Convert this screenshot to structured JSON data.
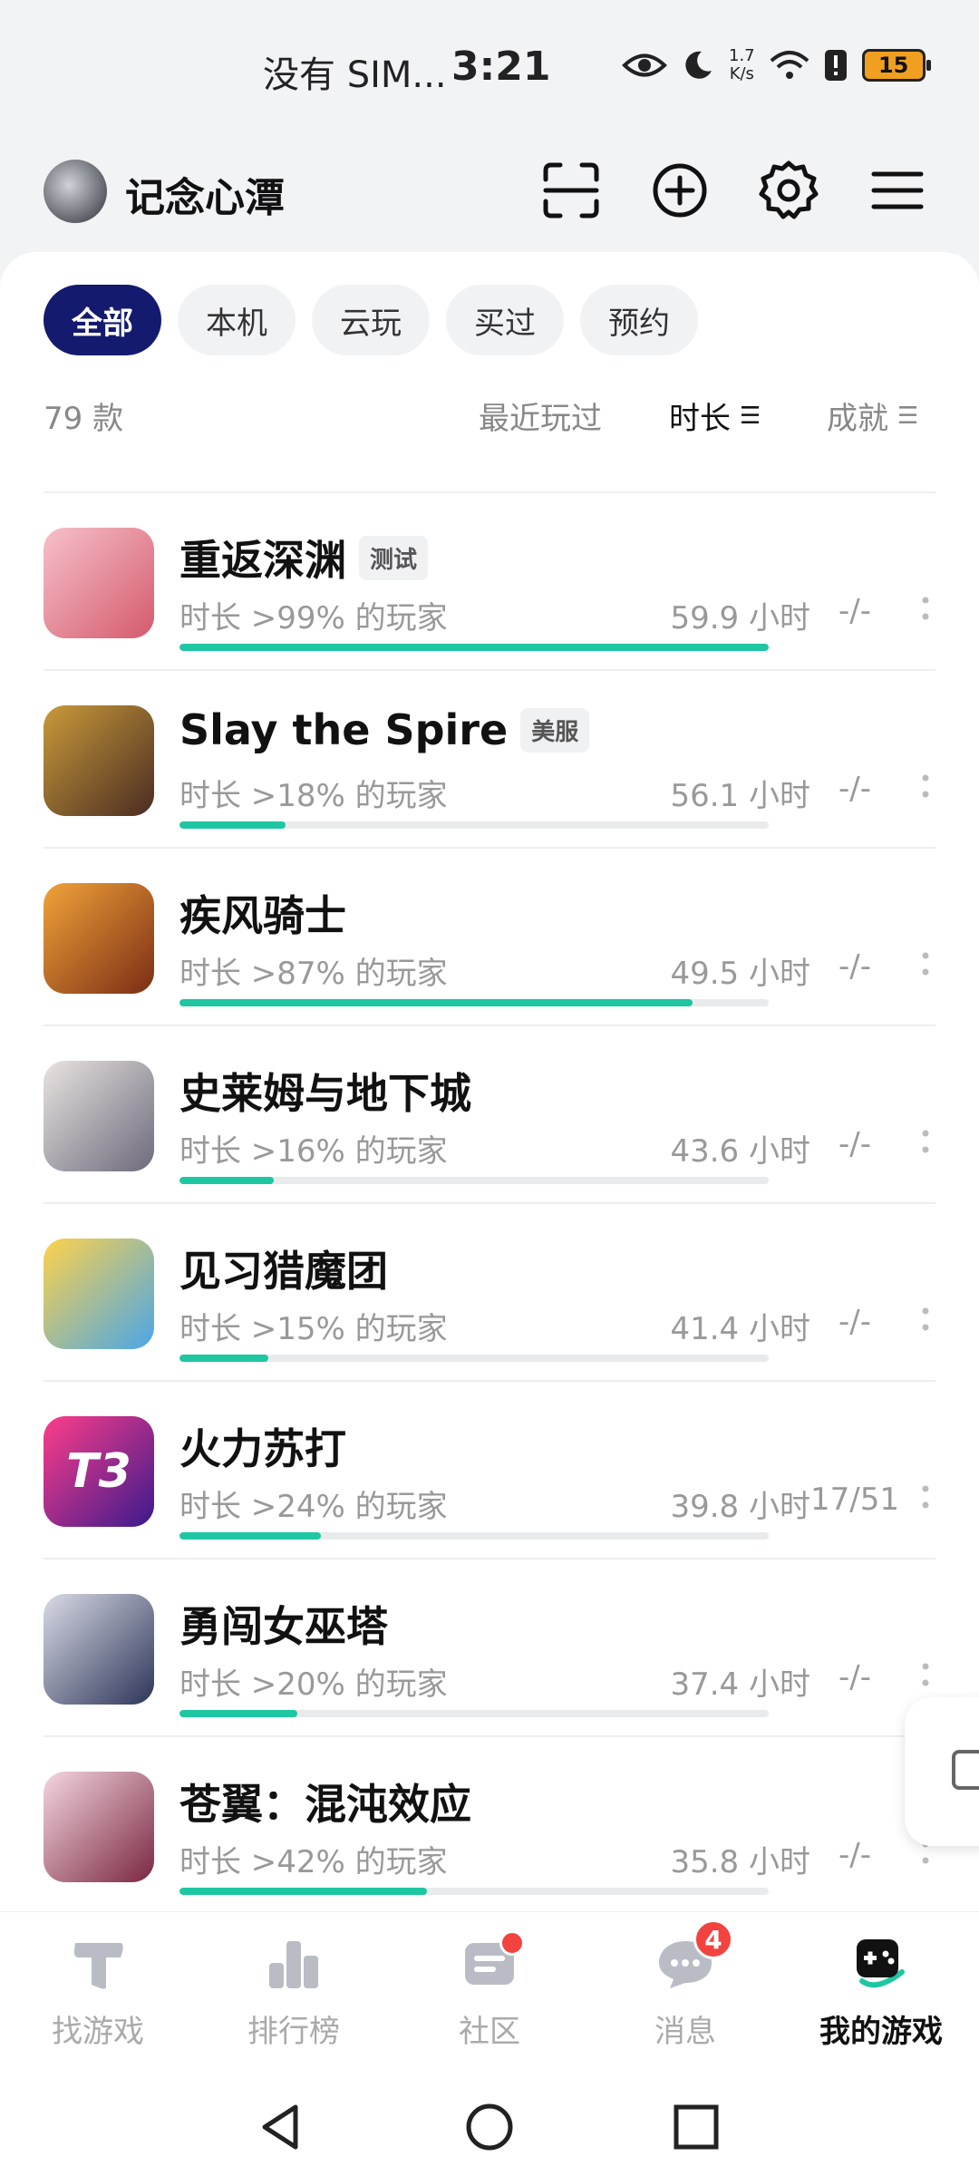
{
  "status": {
    "carrier": "没有 SIM...",
    "time": "3:21",
    "net_top": "1.7",
    "net_bottom": "K/s",
    "battery": "15"
  },
  "header": {
    "username": "记念心潭",
    "icons": [
      "scan-icon",
      "add-circle-icon",
      "gear-icon",
      "menu-icon"
    ]
  },
  "filters": [
    "全部",
    "本机",
    "云玩",
    "买过",
    "预约"
  ],
  "active_filter": 0,
  "game_count": "79 款",
  "sort": {
    "recent": "最近玩过",
    "duration": "时长",
    "achievement": "成就",
    "sort_glyph": "☰"
  },
  "games": [
    {
      "name": "重返深渊",
      "tag": "测试",
      "percent_text": "时长 >99% 的玩家",
      "hours": "59.9 小时",
      "achievement": "-/-",
      "progress": 1.0,
      "icon_colors": [
        "#f7c1c9",
        "#d45a6e"
      ]
    },
    {
      "name": "Slay the Spire",
      "tag": "美服",
      "percent_text": "时长 >18% 的玩家",
      "hours": "56.1 小时",
      "achievement": "-/-",
      "progress": 0.18,
      "icon_colors": [
        "#c99a3a",
        "#4a2c22"
      ]
    },
    {
      "name": "疾风骑士",
      "tag": "",
      "percent_text": "时长 >87% 的玩家",
      "hours": "49.5 小时",
      "achievement": "-/-",
      "progress": 0.87,
      "icon_colors": [
        "#f2a33a",
        "#7a2d14"
      ]
    },
    {
      "name": "史莱姆与地下城",
      "tag": "",
      "percent_text": "时长 >16% 的玩家",
      "hours": "43.6 小时",
      "achievement": "-/-",
      "progress": 0.16,
      "icon_colors": [
        "#e9e4e0",
        "#6d6a7c"
      ]
    },
    {
      "name": "见习猎魔团",
      "tag": "",
      "percent_text": "时长 >15% 的玩家",
      "hours": "41.4 小时",
      "achievement": "-/-",
      "progress": 0.15,
      "icon_colors": [
        "#ffd24a",
        "#4aa6e8"
      ]
    },
    {
      "name": "火力苏打",
      "tag": "",
      "percent_text": "时长 >24% 的玩家",
      "hours": "39.8 小时",
      "achievement": "17/51",
      "progress": 0.24,
      "icon_colors": [
        "#ff3d8a",
        "#3a1a8c"
      ],
      "icon_text": "T3"
    },
    {
      "name": "勇闯女巫塔",
      "tag": "",
      "percent_text": "时长 >20% 的玩家",
      "hours": "37.4 小时",
      "achievement": "-/-",
      "progress": 0.2,
      "icon_colors": [
        "#d9dbe6",
        "#2d3558"
      ]
    },
    {
      "name": "苍翼：混沌效应",
      "tag": "",
      "percent_text": "时长 >42% 的玩家",
      "hours": "35.8 小时",
      "achievement": "-/-",
      "progress": 0.42,
      "icon_colors": [
        "#f4d6e0",
        "#7a2740"
      ]
    }
  ],
  "tabs": [
    {
      "label": "找游戏",
      "icon": "t-logo-icon"
    },
    {
      "label": "排行榜",
      "icon": "ranking-icon"
    },
    {
      "label": "社区",
      "icon": "community-icon",
      "dot": true
    },
    {
      "label": "消息",
      "icon": "message-icon",
      "badge": "4"
    },
    {
      "label": "我的游戏",
      "icon": "gamepad-icon",
      "active": true
    }
  ],
  "colors": {
    "accent": "#141a6e",
    "progress": "#1ec6a2",
    "badge": "#f3433f"
  }
}
